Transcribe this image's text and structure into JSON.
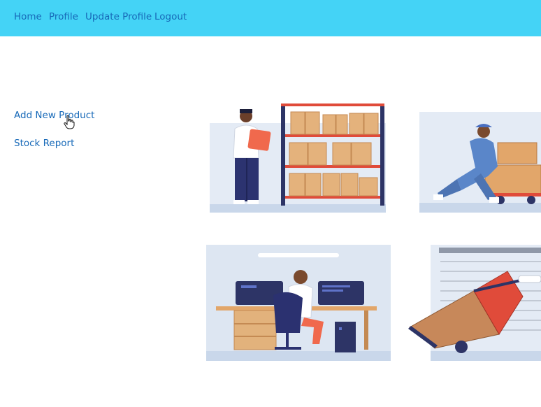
{
  "navbar": {
    "items": [
      {
        "label": "Home"
      },
      {
        "label": "Profile"
      },
      {
        "label": "Update Profile"
      },
      {
        "label": "Logout"
      }
    ],
    "background": "#44d3f6",
    "link_color": "#1769b8"
  },
  "sidebar": {
    "items": [
      {
        "label": "Add New Product"
      },
      {
        "label": "Stock Report"
      }
    ]
  },
  "cursor": {
    "icon": "hand-pointer-icon"
  },
  "illustrations": [
    {
      "icon": "warehouse-clipboard-shelves-icon"
    },
    {
      "icon": "worker-pushing-cart-icon"
    },
    {
      "icon": "office-computer-desk-icon"
    },
    {
      "icon": "hand-truck-boxes-icon"
    }
  ]
}
